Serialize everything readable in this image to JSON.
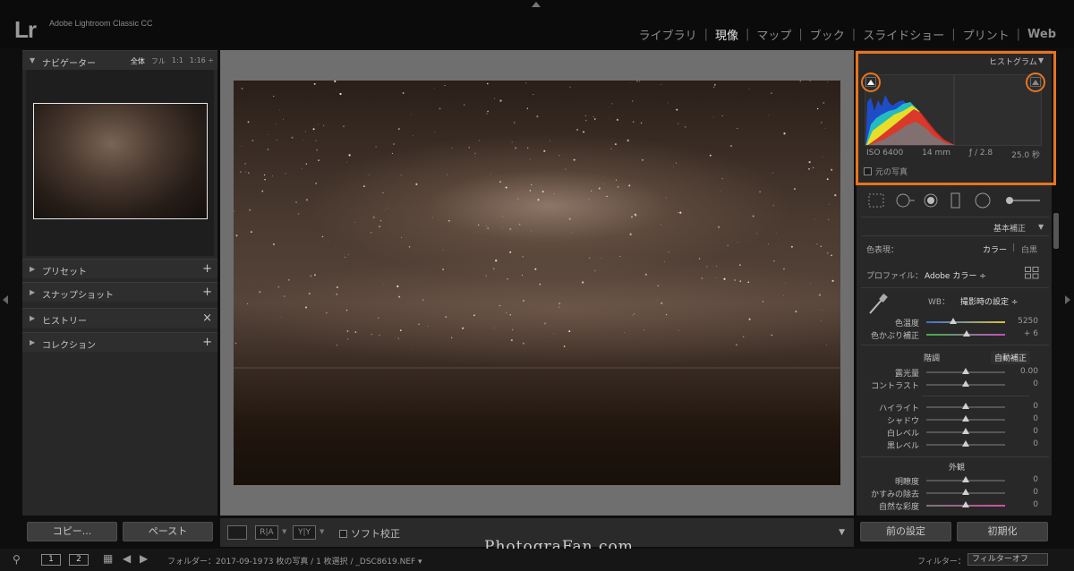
{
  "app": {
    "logo": "Lr",
    "title": "Adobe Lightroom Classic CC"
  },
  "modules": [
    "ライブラリ",
    "現像",
    "マップ",
    "ブック",
    "スライドショー",
    "プリント",
    "Web"
  ],
  "active_module": "現像",
  "left_panel": {
    "navigator": {
      "label": "ナビゲーター",
      "options": [
        "全体",
        "フル",
        "1:1",
        "1:16 ÷"
      ]
    },
    "sections": [
      {
        "label": "プリセット",
        "action": "+"
      },
      {
        "label": "スナップショット",
        "action": "+"
      },
      {
        "label": "ヒストリー",
        "action": "×"
      },
      {
        "label": "コレクション",
        "action": "+"
      }
    ],
    "copy_button": "コピー...",
    "paste_button": "ペースト"
  },
  "toolbar": {
    "view_icon_1": "",
    "view_icon_2": "R|A",
    "view_icon_3": "Y|Y",
    "soft_proof": "ソフト校正"
  },
  "histogram": {
    "title": "ヒストグラム",
    "iso": "ISO 6400",
    "focal": "14 mm",
    "aperture": "ƒ / 2.8",
    "shutter": "25.0 秒",
    "original_photo": "元の写真"
  },
  "basic": {
    "title": "基本補正",
    "treatment_label": "色表現：",
    "treatment_color": "カラー",
    "treatment_bw": "白黒",
    "profile_label": "プロファイル：",
    "profile_value": "Adobe カラー ÷",
    "wb_label": "WB：",
    "wb_value": "撮影時の設定 ÷",
    "temp_label": "色温度",
    "temp_value": "5250",
    "tint_label": "色かぶり補正",
    "tint_value": "+ 6",
    "tone_title": "階調",
    "auto_tone": "自動補正",
    "tone_rows": [
      {
        "label": "露光量",
        "value": "0.00"
      },
      {
        "label": "コントラスト",
        "value": "0"
      }
    ],
    "tone_rows2": [
      {
        "label": "ハイライト",
        "value": "0"
      },
      {
        "label": "シャドウ",
        "value": "0"
      },
      {
        "label": "白レベル",
        "value": "0"
      },
      {
        "label": "黒レベル",
        "value": "0"
      }
    ],
    "presence_title": "外観",
    "presence_rows": [
      {
        "label": "明瞭度",
        "value": "0"
      },
      {
        "label": "かすみの除去",
        "value": "0"
      },
      {
        "label": "自然な彩度",
        "value": "0"
      }
    ]
  },
  "right_buttons": {
    "previous": "前の設定",
    "reset": "初期化"
  },
  "bottom": {
    "page1": "1",
    "page2": "2",
    "path": "フォルダー：2017-09-19",
    "count": "73 枚の写真 / 1 枚選択 / _DSC8619.NEF ▾",
    "filter_label": "フィルター：",
    "filter_value": "フィルターオフ"
  },
  "watermark": "PhotograFan.com"
}
